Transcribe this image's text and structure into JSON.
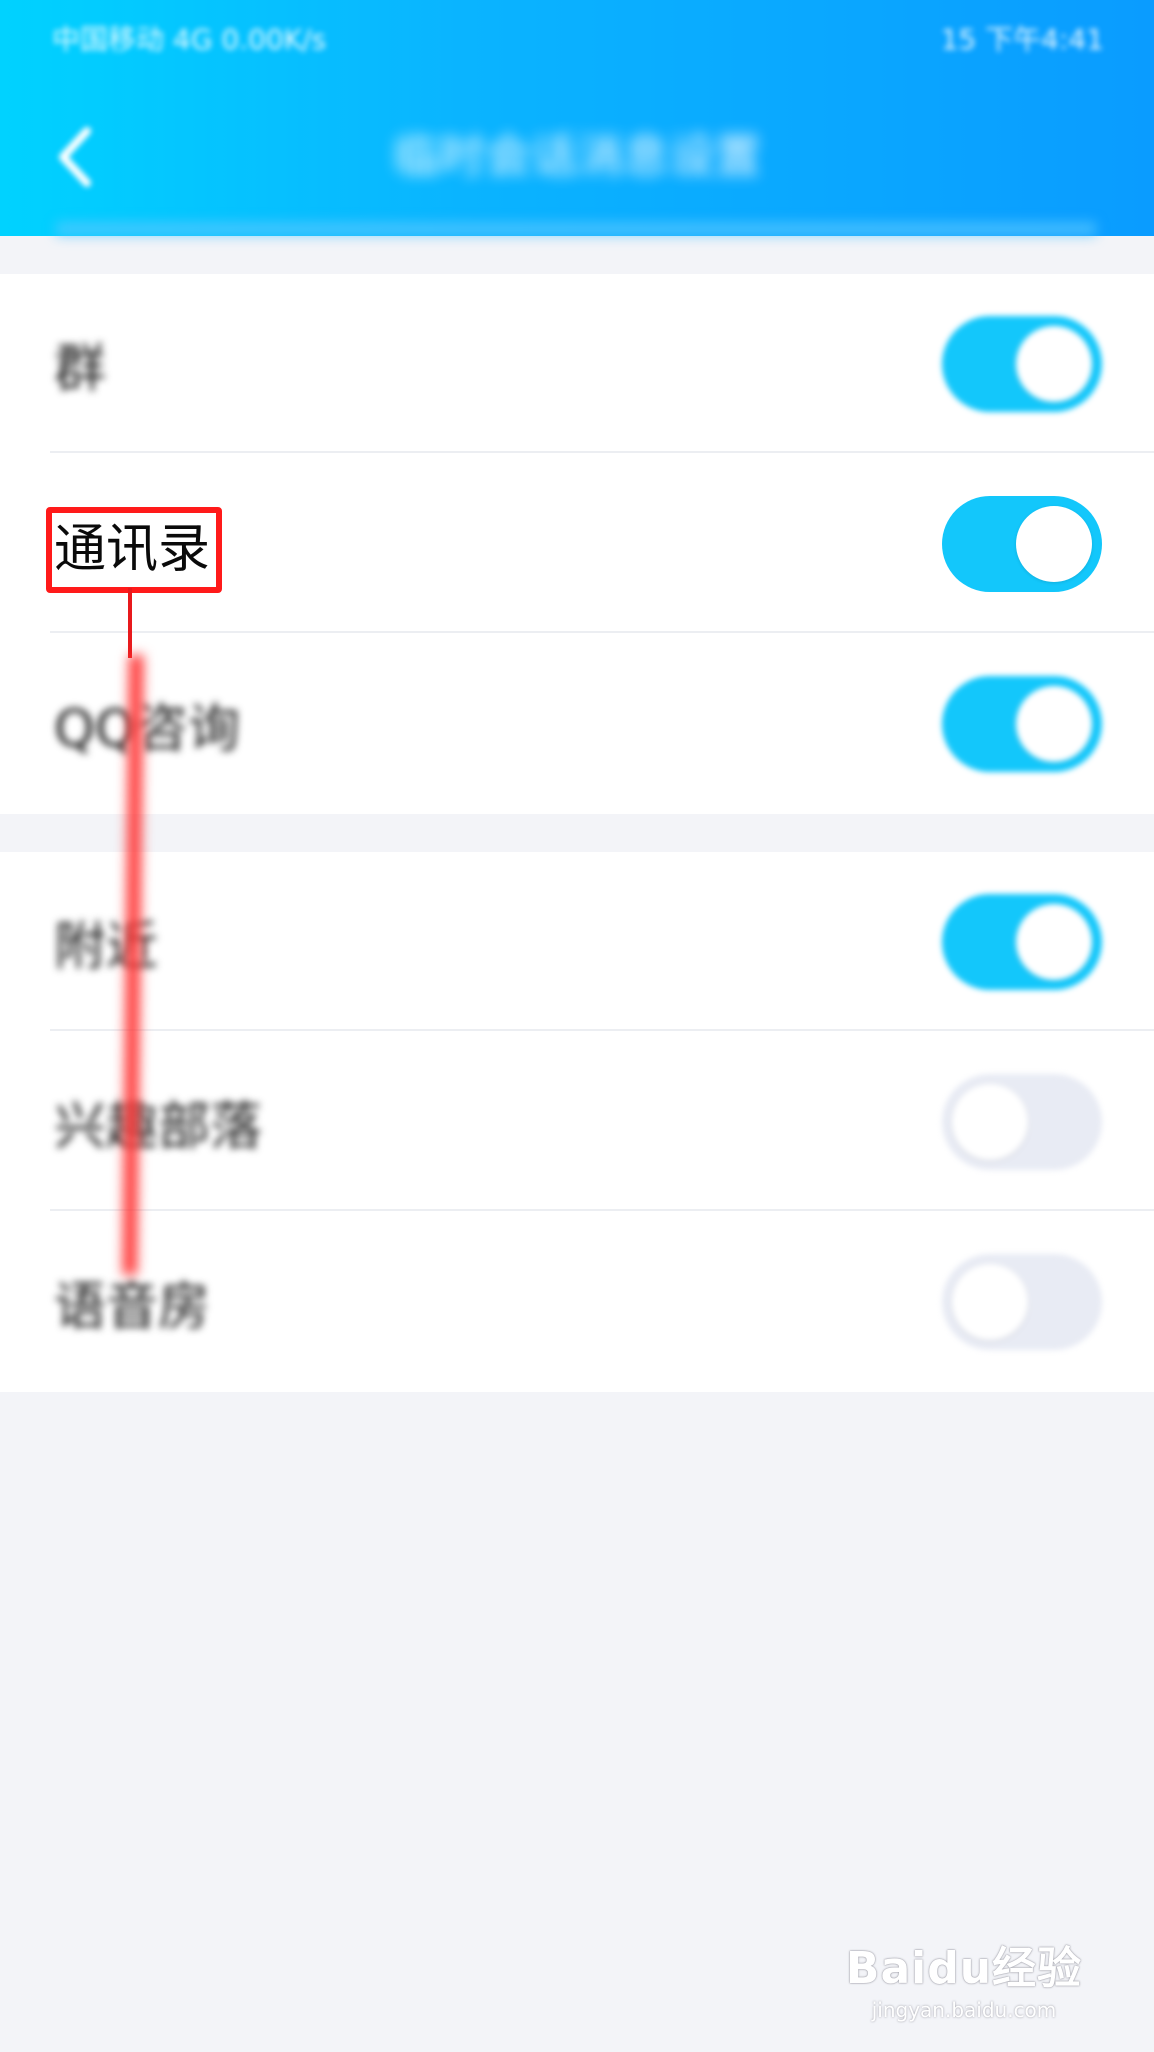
{
  "status_bar": {
    "left_text": "中国移动 4G 0.00K/s",
    "right_text": "15 下午4:41"
  },
  "nav": {
    "back_icon": "chevron-left-icon",
    "title": "临时会话消息设置"
  },
  "colors": {
    "header_gradient_start": "#00d2ff",
    "header_gradient_end": "#0a9cff",
    "toggle_on": "#13c7fb",
    "toggle_off": "#e8ebf4",
    "annotation": "#ff1a1a",
    "page_background": "#f3f4f8"
  },
  "groups": [
    {
      "rows": [
        {
          "label": "群",
          "enabled": true
        },
        {
          "label": "通讯录",
          "enabled": true
        },
        {
          "label": "QQ咨询",
          "enabled": true
        }
      ]
    },
    {
      "rows": [
        {
          "label": "附近",
          "enabled": true
        },
        {
          "label": "兴趣部落",
          "enabled": false
        },
        {
          "label": "语音房",
          "enabled": false
        }
      ]
    }
  ],
  "watermark": {
    "logo": "Baidu经验",
    "url": "jingyan.baidu.com"
  }
}
